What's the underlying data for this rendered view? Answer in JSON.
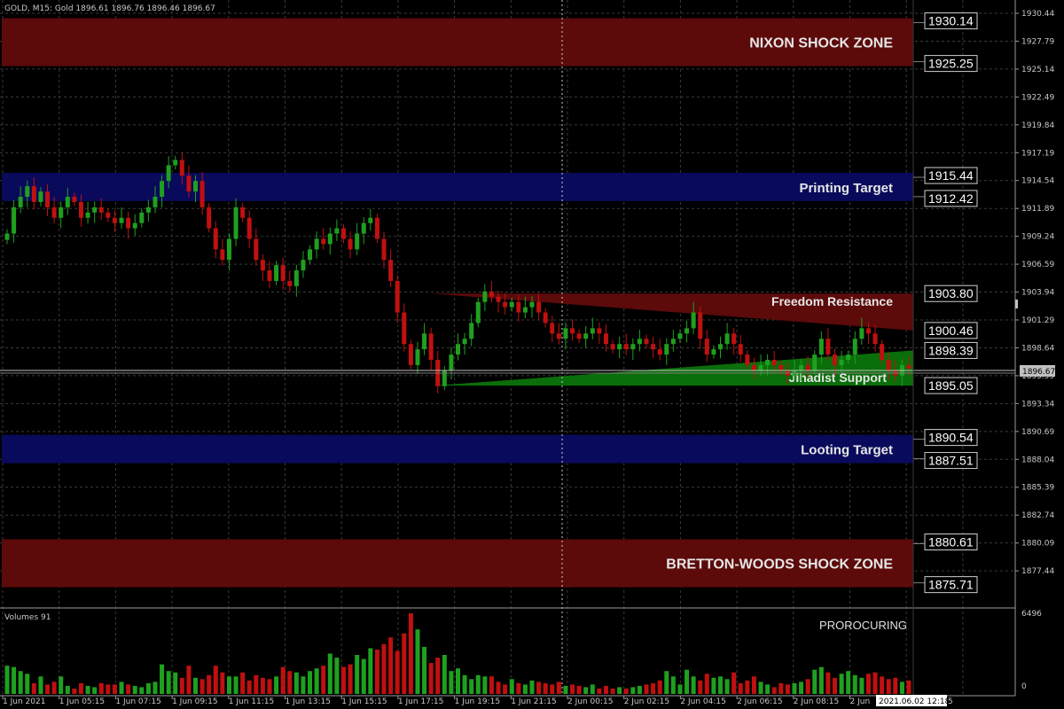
{
  "header": {
    "symbol_info": "GOLD, M15:  Gold  1896.61 1896.76 1896.46 1896.67"
  },
  "volume_panel": {
    "title": "Volumes 91",
    "corner_label": "PROROCURING",
    "axis_top": "6496",
    "axis_bottom": "0"
  },
  "price_axis_ticks": [
    "1930.44",
    "1927.79",
    "1925.14",
    "1922.49",
    "1919.84",
    "1917.19",
    "1914.54",
    "1911.89",
    "1909.24",
    "1906.59",
    "1903.94",
    "1901.29",
    "1898.64",
    "1895.99",
    "1893.34",
    "1890.69",
    "1888.04",
    "1885.39",
    "1882.74",
    "1880.09",
    "1877.44"
  ],
  "time_axis_ticks": [
    "1 Jun 2021",
    "1 Jun 05:15",
    "1 Jun 07:15",
    "1 Jun 09:15",
    "1 Jun 11:15",
    "1 Jun 13:15",
    "1 Jun 15:15",
    "1 Jun 17:15",
    "1 Jun 19:15",
    "1 Jun 21:15",
    "2 Jun 00:15",
    "2 Jun 02:15",
    "2 Jun 04:15",
    "2 Jun 06:15",
    "2 Jun 08:15",
    "2 Jun"
  ],
  "current_price": "1896.67",
  "crosshair_date": "2021.06.02 12:18",
  "crosshair_date_tail": "5",
  "zones": [
    {
      "label": "NIXON SHOCK ZONE",
      "top_price": "1930.14",
      "bottom_price": "1925.25",
      "color": "#5c0a0a"
    },
    {
      "label": "Printing Target",
      "top_price": "1915.44",
      "bottom_price": "1912.42",
      "color": "#0a0a5c"
    },
    {
      "label": "Looting Target",
      "top_price": "1890.54",
      "bottom_price": "1887.51",
      "color": "#0a0a5c"
    },
    {
      "label": "BRETTON-WOODS SHOCK ZONE",
      "top_price": "1880.61",
      "bottom_price": "1875.71",
      "color": "#5c0a0a"
    }
  ],
  "triangles": [
    {
      "label": "Freedom Resistance",
      "top_price": "1903.80",
      "bottom_price": "1900.46",
      "color": "#5c0a0a"
    },
    {
      "label": "Jihadist Support",
      "top_price": "1898.39",
      "bottom_price": "1895.05",
      "color": "#0a6e0a"
    }
  ],
  "colors": {
    "bull": "#1fa01f",
    "bear": "#c01010",
    "background": "#000000",
    "grid": "#3a3a3a"
  },
  "chart_data": {
    "type": "candlestick",
    "y_range": [
      1875.0,
      1932.0
    ],
    "closes": [
      1909.5,
      1912.0,
      1913.0,
      1914.0,
      1912.5,
      1913.5,
      1912.0,
      1911.0,
      1912.0,
      1913.0,
      1912.5,
      1911.0,
      1911.5,
      1912.0,
      1911.5,
      1911.0,
      1910.5,
      1911.0,
      1910.0,
      1910.5,
      1911.5,
      1912.0,
      1913.0,
      1914.5,
      1916.0,
      1916.5,
      1915.0,
      1913.5,
      1914.5,
      1912.0,
      1910.0,
      1908.0,
      1907.0,
      1909.0,
      1912.0,
      1911.0,
      1909.0,
      1907.0,
      1906.0,
      1905.0,
      1906.5,
      1905.0,
      1904.5,
      1906.0,
      1907.0,
      1908.0,
      1909.0,
      1908.5,
      1909.5,
      1910.0,
      1909.0,
      1908.0,
      1909.5,
      1910.5,
      1911.0,
      1909.0,
      1907.0,
      1905.0,
      1902.0,
      1899.0,
      1897.0,
      1898.5,
      1900.0,
      1897.5,
      1895.0,
      1896.5,
      1898.0,
      1899.0,
      1899.5,
      1901.0,
      1903.0,
      1904.0,
      1903.5,
      1903.0,
      1902.5,
      1903.0,
      1902.0,
      1902.5,
      1903.0,
      1902.0,
      1901.0,
      1900.0,
      1899.5,
      1900.5,
      1900.0,
      1899.5,
      1900.0,
      1900.5,
      1900.0,
      1899.0,
      1898.5,
      1899.0,
      1898.5,
      1899.0,
      1899.5,
      1899.0,
      1898.5,
      1898.0,
      1899.0,
      1899.5,
      1900.0,
      1900.5,
      1902.0,
      1899.5,
      1898.0,
      1898.5,
      1899.0,
      1900.0,
      1899.0,
      1898.0,
      1897.0,
      1896.5,
      1897.0,
      1897.5,
      1897.0,
      1896.5,
      1896.0,
      1896.5,
      1897.0,
      1896.5,
      1898.0,
      1899.5,
      1898.0,
      1897.0,
      1897.5,
      1898.0,
      1899.5,
      1900.5,
      1900.0,
      1899.0,
      1897.5,
      1896.5,
      1896.0,
      1897.0,
      1896.67
    ],
    "volumes": [
      0.21,
      0.2,
      0.17,
      0.15,
      0.08,
      0.13,
      0.07,
      0.09,
      0.13,
      0.06,
      0.04,
      0.08,
      0.06,
      0.05,
      0.08,
      0.07,
      0.07,
      0.09,
      0.07,
      0.06,
      0.05,
      0.08,
      0.09,
      0.22,
      0.17,
      0.16,
      0.12,
      0.21,
      0.12,
      0.11,
      0.14,
      0.21,
      0.16,
      0.13,
      0.13,
      0.16,
      0.1,
      0.14,
      0.12,
      0.11,
      0.13,
      0.2,
      0.17,
      0.16,
      0.13,
      0.17,
      0.19,
      0.21,
      0.3,
      0.27,
      0.2,
      0.22,
      0.29,
      0.26,
      0.34,
      0.33,
      0.37,
      0.42,
      0.32,
      0.45,
      0.6,
      0.48,
      0.35,
      0.23,
      0.27,
      0.29,
      0.17,
      0.19,
      0.14,
      0.11,
      0.14,
      0.13,
      0.13,
      0.09,
      0.07,
      0.11,
      0.08,
      0.07,
      0.1,
      0.09,
      0.08,
      0.07,
      0.09,
      0.06,
      0.07,
      0.06,
      0.05,
      0.07,
      0.04,
      0.06,
      0.04,
      0.05,
      0.04,
      0.05,
      0.06,
      0.07,
      0.08,
      0.1,
      0.17,
      0.13,
      0.07,
      0.18,
      0.13,
      0.1,
      0.15,
      0.12,
      0.13,
      0.11,
      0.16,
      0.08,
      0.1,
      0.13,
      0.09,
      0.07,
      0.05,
      0.08,
      0.07,
      0.08,
      0.09,
      0.11,
      0.18,
      0.2,
      0.16,
      0.12,
      0.15,
      0.17,
      0.14,
      0.12,
      0.15,
      0.16,
      0.13,
      0.11,
      0.12,
      0.09,
      0.1
    ]
  }
}
